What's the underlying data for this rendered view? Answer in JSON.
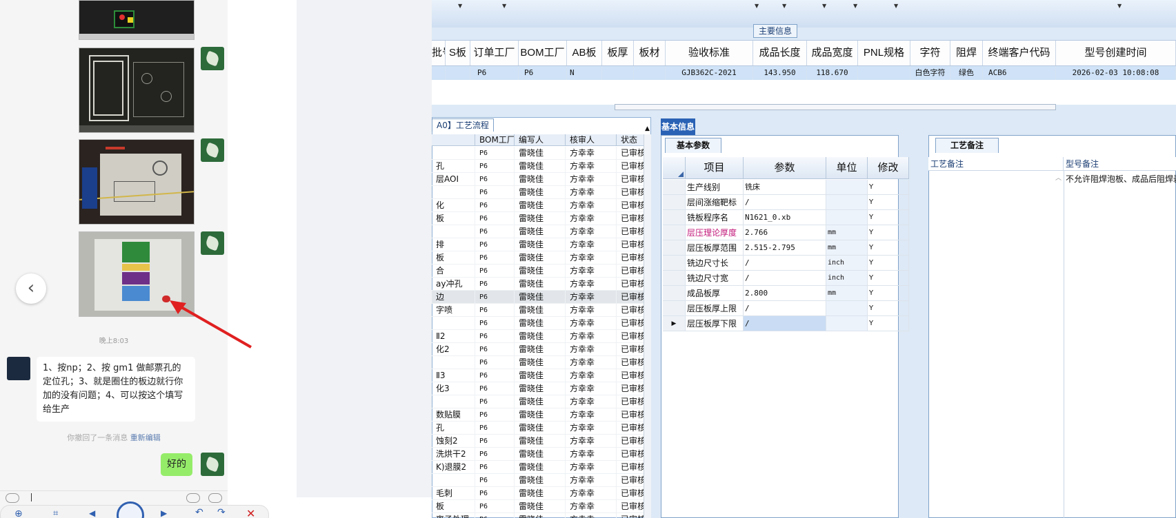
{
  "erp": {
    "main_info_label": "主要信息",
    "columns": [
      {
        "header": "批号",
        "value": ""
      },
      {
        "header": "S板",
        "value": ""
      },
      {
        "header": "订单工厂",
        "value": "P6"
      },
      {
        "header": "BOM工厂",
        "value": "P6"
      },
      {
        "header": "AB板",
        "value": "N"
      },
      {
        "header": "板厚",
        "value": ""
      },
      {
        "header": "板材",
        "value": ""
      },
      {
        "header": "验收标准",
        "value": "GJB362C-2021"
      },
      {
        "header": "成品长度",
        "value": "143.950"
      },
      {
        "header": "成品宽度",
        "value": "118.670"
      },
      {
        "header": "PNL规格",
        "value": ""
      },
      {
        "header": "字符",
        "value": "白色字符"
      },
      {
        "header": "阻焊",
        "value": "绿色"
      },
      {
        "header": "终端客户代码",
        "value": "ACB6"
      },
      {
        "header": "型号创建时间",
        "value": "2026-02-03 10:08:08"
      }
    ],
    "process_tab": "A0】工艺流程",
    "process_headers": [
      "",
      "BOM工厂",
      "编写人",
      "核审人",
      "状态"
    ],
    "process_rows": [
      [
        "",
        "P6",
        "雷晓佳",
        "方幸幸",
        "已审核"
      ],
      [
        "孔",
        "P6",
        "雷晓佳",
        "方幸幸",
        "已审核"
      ],
      [
        "层AOI",
        "P6",
        "雷晓佳",
        "方幸幸",
        "已审核"
      ],
      [
        "",
        "P6",
        "雷晓佳",
        "方幸幸",
        "已审核"
      ],
      [
        "化",
        "P6",
        "雷晓佳",
        "方幸幸",
        "已审核"
      ],
      [
        "板",
        "P6",
        "雷晓佳",
        "方幸幸",
        "已审核"
      ],
      [
        "",
        "P6",
        "雷晓佳",
        "方幸幸",
        "已审核"
      ],
      [
        "排",
        "P6",
        "雷晓佳",
        "方幸幸",
        "已审核"
      ],
      [
        "板",
        "P6",
        "雷晓佳",
        "方幸幸",
        "已审核"
      ],
      [
        "合",
        "P6",
        "雷晓佳",
        "方幸幸",
        "已审核"
      ],
      [
        "ay冲孔",
        "P6",
        "雷晓佳",
        "方幸幸",
        "已审核"
      ],
      [
        "边",
        "P6",
        "雷晓佳",
        "方幸幸",
        "已审核"
      ],
      [
        "字喷",
        "P6",
        "雷晓佳",
        "方幸幸",
        "已审核"
      ],
      [
        "",
        "P6",
        "雷晓佳",
        "方幸幸",
        "已审核"
      ],
      [
        "Ⅱ2",
        "P6",
        "雷晓佳",
        "方幸幸",
        "已审核"
      ],
      [
        "化2",
        "P6",
        "雷晓佳",
        "方幸幸",
        "已审核"
      ],
      [
        "",
        "P6",
        "雷晓佳",
        "方幸幸",
        "已审核"
      ],
      [
        "Ⅱ3",
        "P6",
        "雷晓佳",
        "方幸幸",
        "已审核"
      ],
      [
        "化3",
        "P6",
        "雷晓佳",
        "方幸幸",
        "已审核"
      ],
      [
        "",
        "P6",
        "雷晓佳",
        "方幸幸",
        "已审核"
      ],
      [
        "数贴膜",
        "P6",
        "雷晓佳",
        "方幸幸",
        "已审核"
      ],
      [
        "孔",
        "P6",
        "雷晓佳",
        "方幸幸",
        "已审核"
      ],
      [
        "蚀刻2",
        "P6",
        "雷晓佳",
        "方幸幸",
        "已审核"
      ],
      [
        "洗烘干2",
        "P6",
        "雷晓佳",
        "方幸幸",
        "已审核"
      ],
      [
        "K)退膜2",
        "P6",
        "雷晓佳",
        "方幸幸",
        "已审核"
      ],
      [
        "",
        "P6",
        "雷晓佳",
        "方幸幸",
        "已审核"
      ],
      [
        "毛刺",
        "P6",
        "雷晓佳",
        "方幸幸",
        "已审核"
      ],
      [
        "板",
        "P6",
        "雷晓佳",
        "方幸幸",
        "已审核"
      ],
      [
        "离子处理",
        "P6",
        "雷晓佳",
        "方幸幸",
        "已审核"
      ]
    ],
    "basic_info_title": "基本信息",
    "basic_params_tab": "基本参数",
    "param_headers": [
      "项目",
      "参数",
      "单位",
      "修改"
    ],
    "params": [
      {
        "item": "生产线别",
        "value": "铣床",
        "unit": "",
        "edit": "Y"
      },
      {
        "item": "层间涨缩靶标",
        "value": "/",
        "unit": "",
        "edit": "Y"
      },
      {
        "item": "铣板程序名",
        "value": "N1621_0.xb",
        "unit": "",
        "edit": "Y"
      },
      {
        "item": "层压理论厚度",
        "value": "2.766",
        "unit": "mm",
        "edit": "Y"
      },
      {
        "item": "层压板厚范围",
        "value": "2.515-2.795",
        "unit": "mm",
        "edit": "Y"
      },
      {
        "item": "铣边尺寸长",
        "value": "/",
        "unit": "inch",
        "edit": "Y"
      },
      {
        "item": "铣边尺寸宽",
        "value": "/",
        "unit": "inch",
        "edit": "Y"
      },
      {
        "item": "成品板厚",
        "value": "2.800",
        "unit": "mm",
        "edit": "Y"
      },
      {
        "item": "层压板厚上限",
        "value": "/",
        "unit": "",
        "edit": "Y"
      },
      {
        "item": "层压板厚下限",
        "value": "/",
        "unit": "",
        "edit": "Y"
      }
    ],
    "process_notes_tab": "工艺备注",
    "process_notes_label": "工艺备注",
    "model_notes_label": "型号备注",
    "model_notes_text": "不允许阻焊泡板、成品后阻焊剥"
  },
  "chat": {
    "time_label": "晚上8:03",
    "incoming_message": "1、按np；2、按 gm1 做邮票孔的定位孔；3、就是圈住的板边就行你加的没有问题；4、可以按这个填写给生产",
    "recall_text": "你撤回了一条消息",
    "reedit_text": "重新编辑",
    "outgoing_message": "好的"
  }
}
